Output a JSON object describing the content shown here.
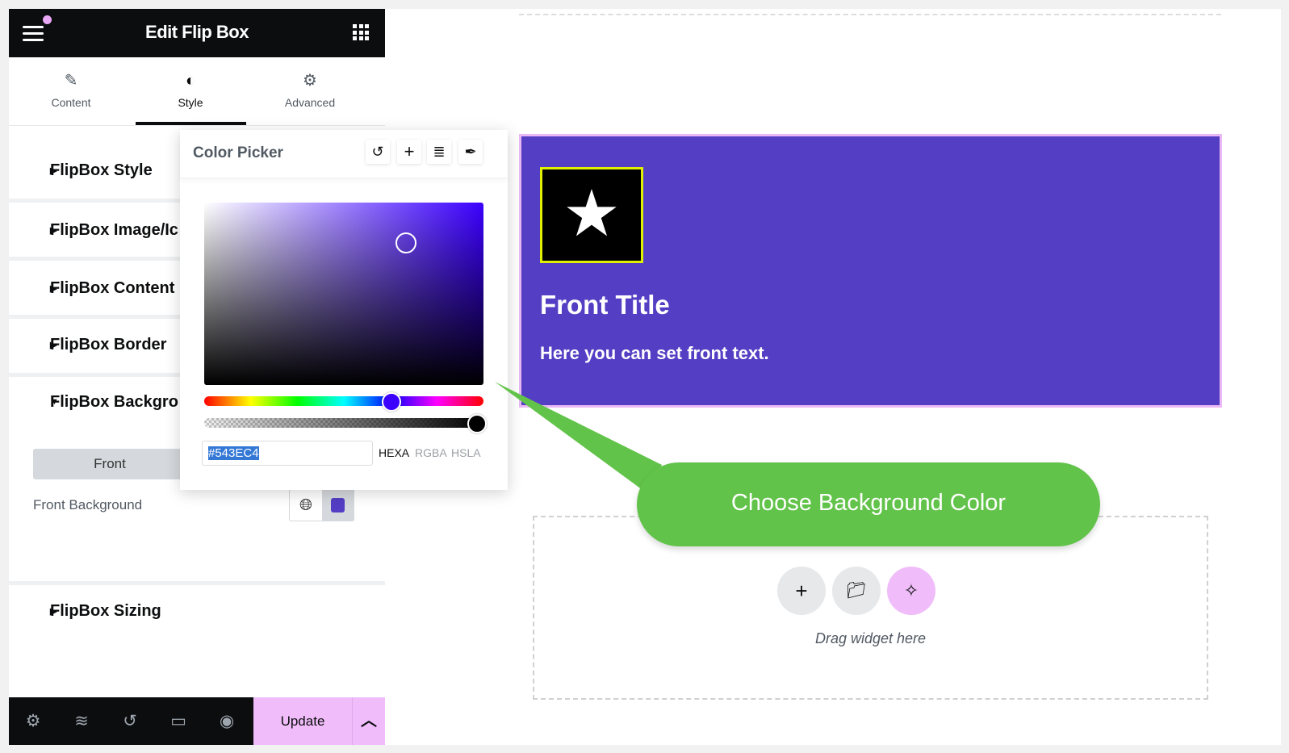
{
  "panel": {
    "title": "Edit Flip Box",
    "tabs": [
      {
        "label": "Content",
        "icon": "pencil-icon"
      },
      {
        "label": "Style",
        "icon": "half-circle-icon",
        "active": true
      },
      {
        "label": "Advanced",
        "icon": "gear-icon"
      }
    ],
    "sections": [
      {
        "label": "FlipBox Style"
      },
      {
        "label": "FlipBox Image/Ic"
      },
      {
        "label": "FlipBox Content"
      },
      {
        "label": "FlipBox Border"
      },
      {
        "label": "FlipBox Backgro",
        "expanded": true
      },
      {
        "label": "FlipBox Sizing"
      }
    ],
    "background": {
      "front_button": "Front",
      "front_background_label": "Front Background",
      "front_color": "#543ec4"
    },
    "bottom_bar": {
      "update_label": "Update"
    }
  },
  "color_picker": {
    "title": "Color Picker",
    "hex_value": "#543EC4",
    "modes": [
      "HEXA",
      "RGBA",
      "HSLA"
    ],
    "active_mode": "HEXA",
    "alpha": 1
  },
  "canvas": {
    "flipbox": {
      "title": "Front Title",
      "text": "Here you can set front text.",
      "background": "#543ec4"
    },
    "drop_zone_text": "Drag widget here"
  },
  "callout": {
    "text": "Choose Background Color",
    "color": "#62c34a"
  }
}
